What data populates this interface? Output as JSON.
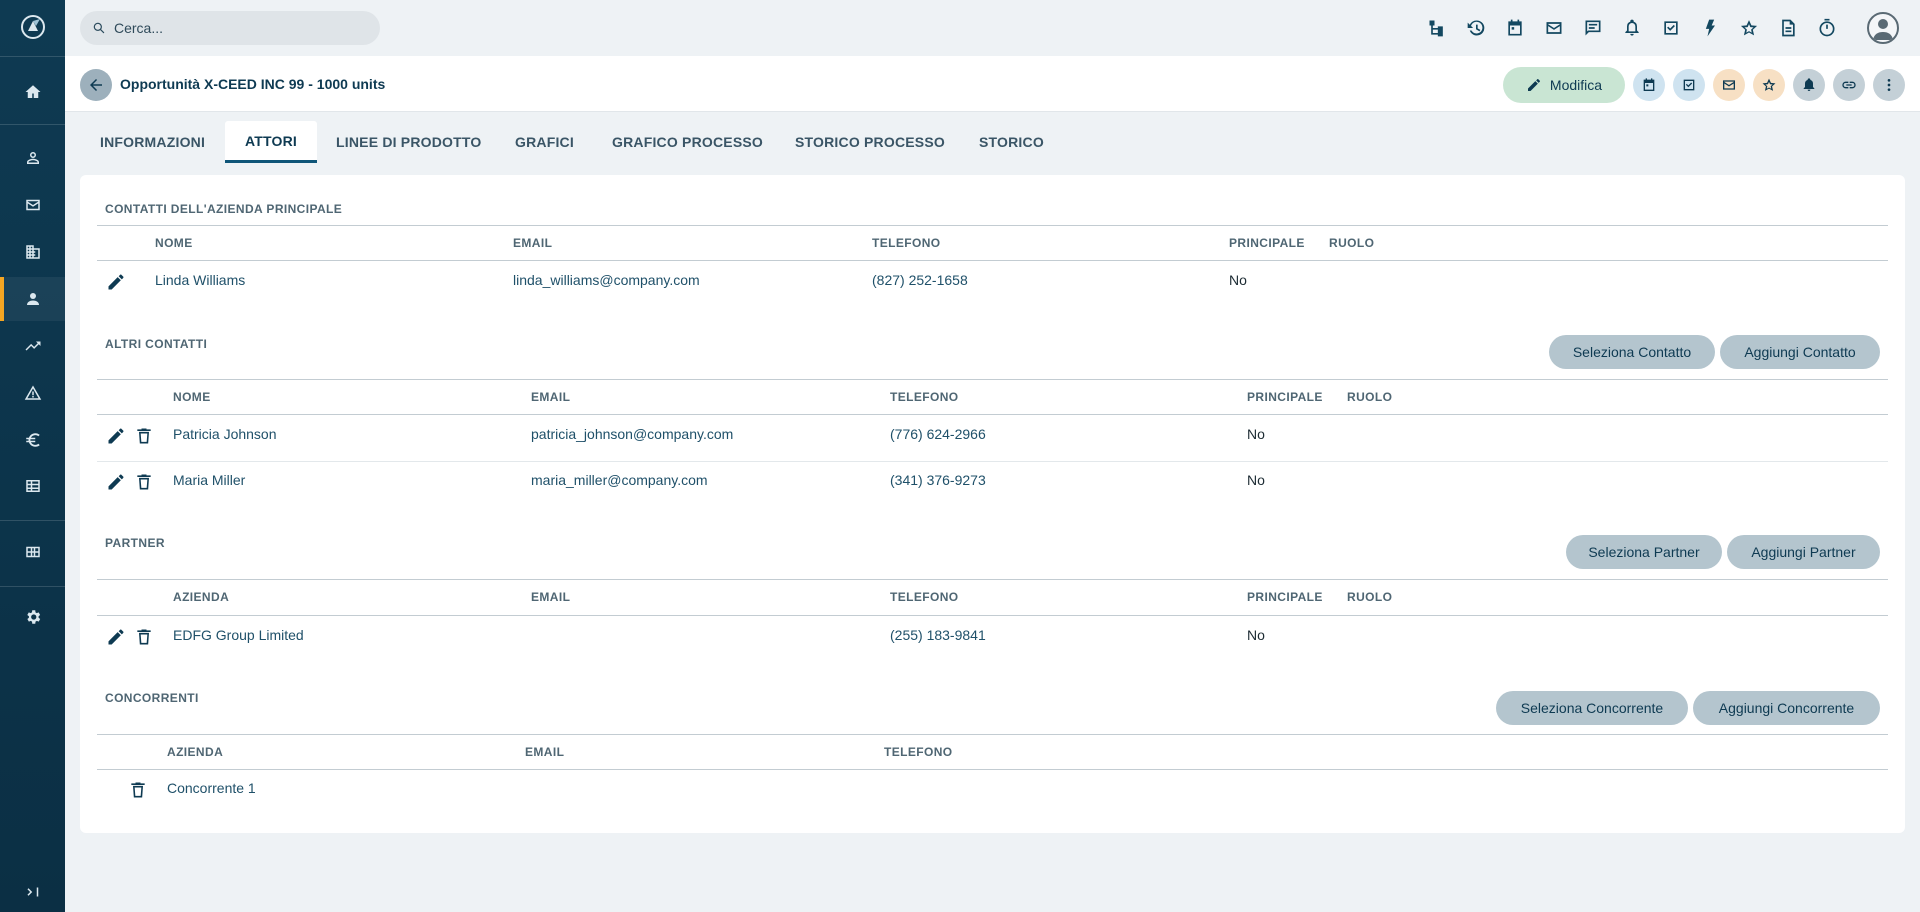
{
  "search": {
    "placeholder": "Cerca..."
  },
  "header": {
    "title": "Opportunità X-CEED INC 99 - 1000 units",
    "edit_label": "Modifica"
  },
  "tabs": [
    {
      "label": "INFORMAZIONI"
    },
    {
      "label": "ATTORI"
    },
    {
      "label": "LINEE DI PRODOTTO"
    },
    {
      "label": "GRAFICI"
    },
    {
      "label": "GRAFICO PROCESSO"
    },
    {
      "label": "STORICO PROCESSO"
    },
    {
      "label": "STORICO"
    }
  ],
  "sections": {
    "main_contacts": {
      "title": "CONTATTI DELL'AZIENDA PRINCIPALE",
      "columns": [
        "NOME",
        "EMAIL",
        "TELEFONO",
        "PRINCIPALE",
        "RUOLO"
      ],
      "rows": [
        {
          "name": "Linda Williams",
          "email": "linda_williams@company.com",
          "phone": "(827) 252-1658",
          "primary": "No",
          "role": ""
        }
      ]
    },
    "other_contacts": {
      "title": "ALTRI CONTATTI",
      "select_label": "Seleziona Contatto",
      "add_label": "Aggiungi Contatto",
      "columns": [
        "NOME",
        "EMAIL",
        "TELEFONO",
        "PRINCIPALE",
        "RUOLO"
      ],
      "rows": [
        {
          "name": "Patricia Johnson",
          "email": "patricia_johnson@company.com",
          "phone": "(776) 624-2966",
          "primary": "No",
          "role": ""
        },
        {
          "name": "Maria Miller",
          "email": "maria_miller@company.com",
          "phone": "(341) 376-9273",
          "primary": "No",
          "role": ""
        }
      ]
    },
    "partner": {
      "title": "PARTNER",
      "select_label": "Seleziona Partner",
      "add_label": "Aggiungi Partner",
      "columns": [
        "AZIENDA",
        "EMAIL",
        "TELEFONO",
        "PRINCIPALE",
        "RUOLO"
      ],
      "rows": [
        {
          "name": "EDFG Group Limited",
          "email": "",
          "phone": "(255) 183-9841",
          "primary": "No",
          "role": ""
        }
      ]
    },
    "competitors": {
      "title": "CONCORRENTI",
      "select_label": "Seleziona Concorrente",
      "add_label": "Aggiungi Concorrente",
      "columns": [
        "AZIENDA",
        "EMAIL",
        "TELEFONO"
      ],
      "rows": [
        {
          "name": "Concorrente 1",
          "email": "",
          "phone": ""
        }
      ]
    }
  },
  "icons": {
    "sidebar": [
      "home-icon",
      "person-outline-icon",
      "mail-icon",
      "building-icon",
      "person-icon",
      "trending-up-icon",
      "warning-icon",
      "euro-icon",
      "table-icon",
      "grid-icon",
      "gear-icon",
      "collapse-icon"
    ],
    "topbar": [
      "hierarchy-icon",
      "history-icon",
      "calendar-icon",
      "mail-icon",
      "chat-icon",
      "bell-icon",
      "task-icon",
      "flash-icon",
      "star-icon",
      "document-icon",
      "timer-icon"
    ]
  },
  "colors": {
    "sidebar_bg": "#0e3a52",
    "sidebar_active_accent": "#f5a623",
    "edit_button_bg": "#c9e5d3",
    "pill_bg": "#b4c5ce"
  }
}
